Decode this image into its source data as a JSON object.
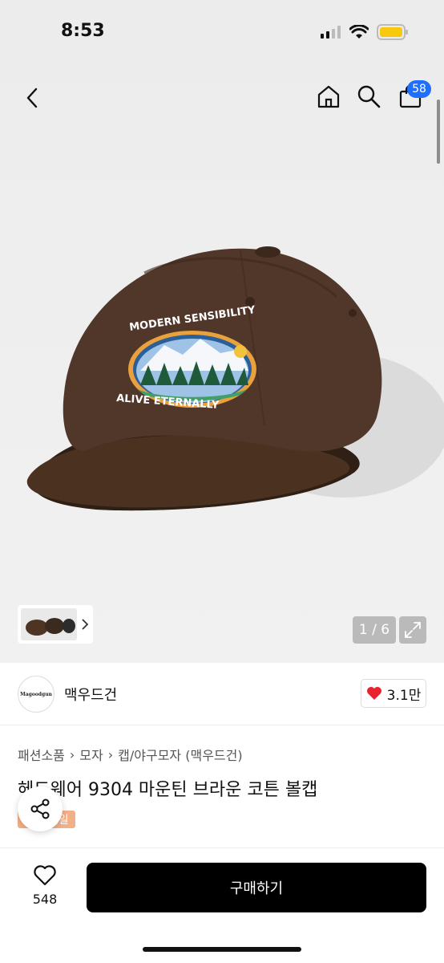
{
  "status": {
    "time": "8:53"
  },
  "nav": {
    "cart_count": "58"
  },
  "gallery": {
    "page_indicator": "1 / 6"
  },
  "brand": {
    "logo_text": "Magoodgun",
    "name": "맥우드건",
    "likes": "3.1만"
  },
  "breadcrumb": [
    "패션소품",
    "모자",
    "캡/야구모자 (맥우드건)"
  ],
  "product": {
    "title": "헤드웨어 9304 마운틴 브라운 코튼 볼캡",
    "sale_tag": "세일",
    "cap_text_top": "MODERN SENSIBILITY",
    "cap_text_bottom": "ALIVE ETERNALLY"
  },
  "bottom_bar": {
    "wish_count": "548",
    "buy_label": "구매하기"
  },
  "colors": {
    "accent": "#1f6fff",
    "cap_brown": "#4e3422",
    "sale_tag": "#f2b088",
    "buy_button": "#000000"
  },
  "icons": [
    "back-icon",
    "home-icon",
    "search-icon",
    "cart-icon",
    "expand-icon",
    "heart-icon",
    "share-icon",
    "chevron-right-icon",
    "signal-icon",
    "wifi-icon",
    "battery-icon"
  ]
}
